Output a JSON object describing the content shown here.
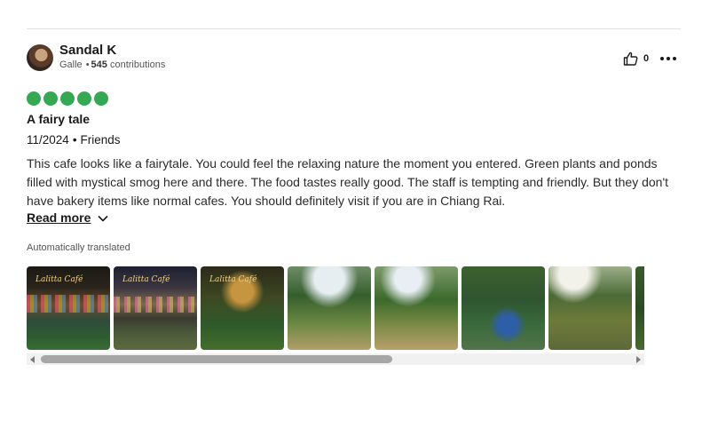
{
  "review": {
    "user": {
      "name": "Sandal K",
      "location": "Galle",
      "contributions_count": "545",
      "contributions_label": "contributions",
      "separator": "•"
    },
    "helpful_count": "0",
    "rating": 5,
    "rating_color": "#34a853",
    "title": "A fairy tale",
    "date": "11/2024",
    "date_separator": "•",
    "trip_type": "Friends",
    "body": "This cafe looks like a fairytale. You could feel the relaxing nature the moment you entered. Green plants and ponds filled with mystical smog here and there. The food tastes really good. The staff is tempting and friendly. But they don't have bakery items like normal cafes. You should definitely visit if you are in Chiang Rai.",
    "read_more_label": "Read more",
    "translation_note": "Automatically translated",
    "photos": [
      {
        "sign_text": "Lalitta Café"
      },
      {
        "sign_text": "Lalitta Café"
      },
      {
        "sign_text": "Lalitta Café"
      },
      {
        "sign_text": ""
      },
      {
        "sign_text": ""
      },
      {
        "sign_text": ""
      },
      {
        "sign_text": ""
      },
      {
        "sign_text": ""
      }
    ],
    "gallery_scroll_position": 0.0
  },
  "icons": {
    "helpful": "thumbs-up-icon",
    "more": "ellipsis-icon",
    "read_more": "chevron-down-icon"
  }
}
